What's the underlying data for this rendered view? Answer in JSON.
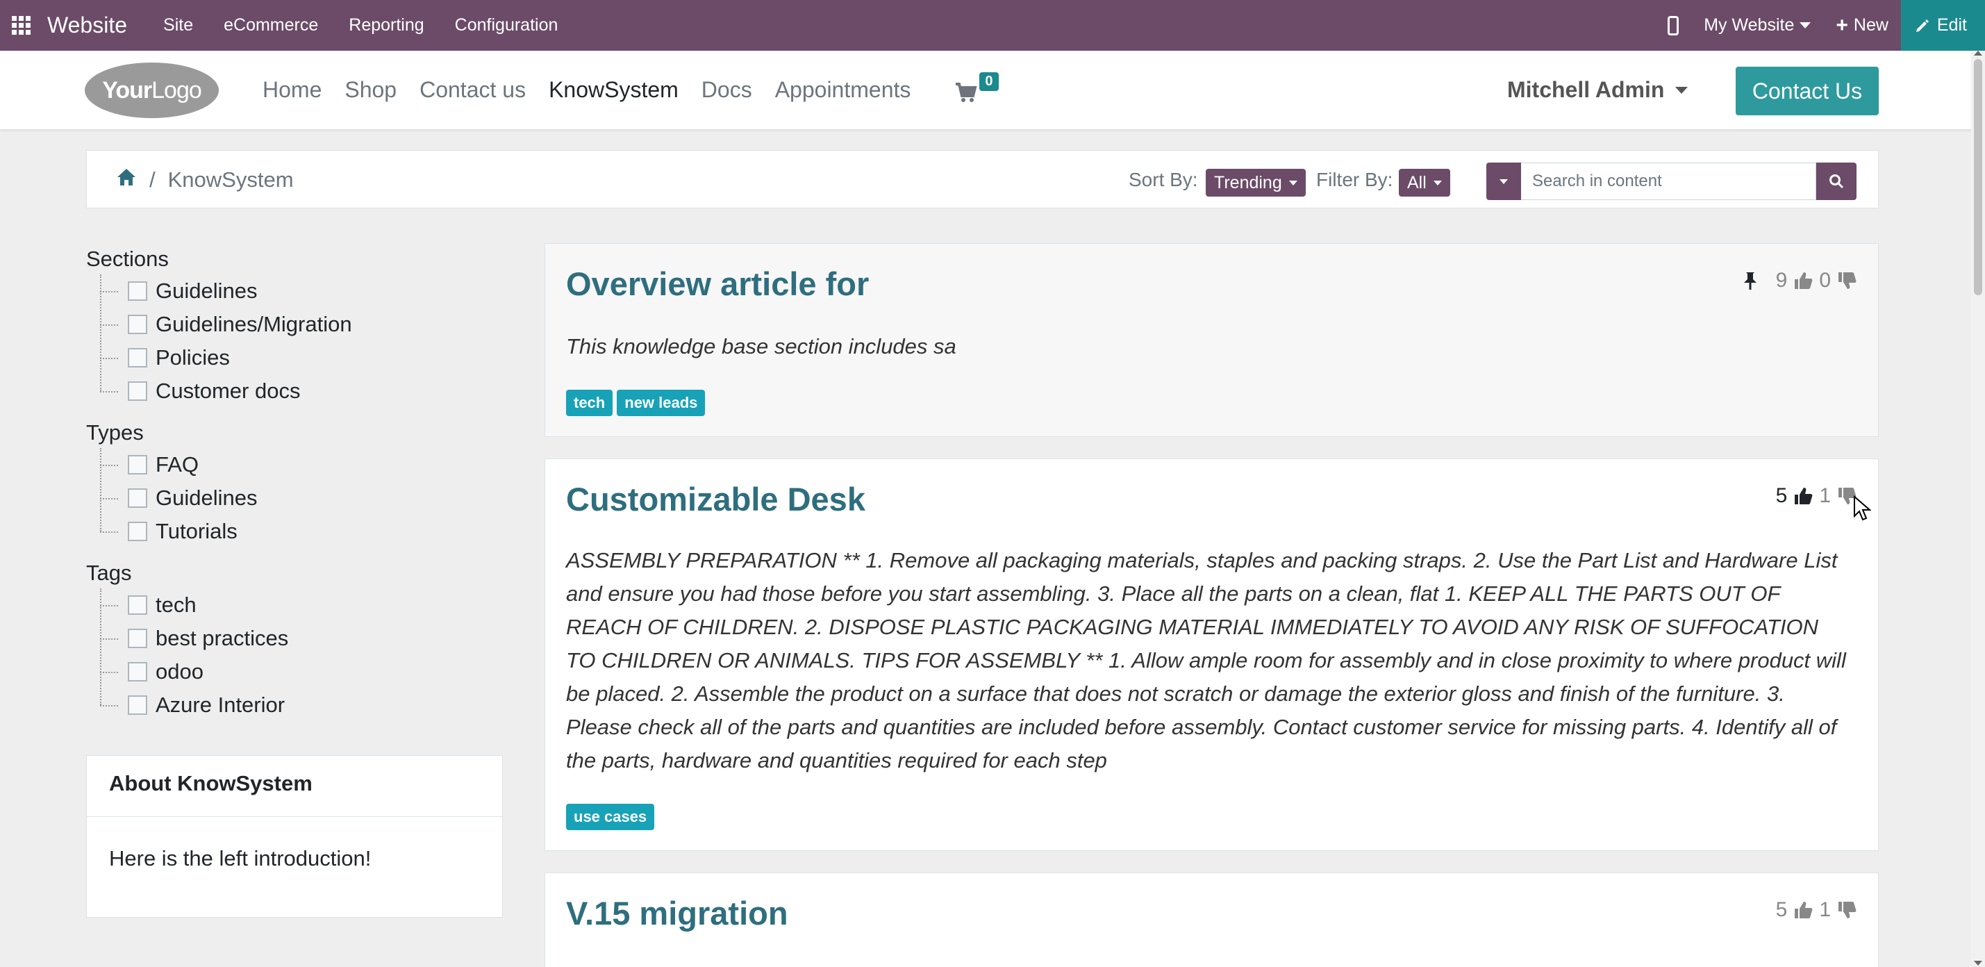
{
  "topbar": {
    "brand": "Website",
    "menus": [
      "Site",
      "eCommerce",
      "Reporting",
      "Configuration"
    ],
    "website_selector": "My Website",
    "new_label": "New",
    "edit_label": "Edit"
  },
  "header": {
    "logo": {
      "bold": "Your",
      "thin": "Logo"
    },
    "nav": [
      "Home",
      "Shop",
      "Contact us",
      "KnowSystem",
      "Docs",
      "Appointments"
    ],
    "active_nav": "KnowSystem",
    "cart_count": "0",
    "user_name": "Mitchell Admin",
    "contact_button": "Contact Us"
  },
  "filterbar": {
    "breadcrumb": "KnowSystem",
    "sort_label": "Sort By:",
    "sort_value": "Trending",
    "filter_label": "Filter By:",
    "filter_value": "All",
    "search_placeholder": "Search in content"
  },
  "sidebar": {
    "sections_title": "Sections",
    "sections": [
      "Guidelines",
      "Guidelines/Migration",
      "Policies",
      "Customer docs"
    ],
    "types_title": "Types",
    "types": [
      "FAQ",
      "Guidelines",
      "Tutorials"
    ],
    "tags_title": "Tags",
    "tags": [
      "tech",
      "best practices",
      "odoo",
      "Azure Interior"
    ],
    "about_title": "About KnowSystem",
    "about_text": "Here is the left introduction!"
  },
  "articles": [
    {
      "title": "Overview article for",
      "text": "This knowledge base section includes sa",
      "tags": [
        "tech",
        "new leads"
      ],
      "likes": "9",
      "dislikes": "0",
      "pinned": true
    },
    {
      "title": "Customizable Desk",
      "text": "ASSEMBLY PREPARATION ** 1. Remove all packaging materials, staples and packing straps. 2. Use the Part List and Hardware List and ensure you had those before you start assembling. 3. Place all the parts on a clean, flat 1. KEEP ALL THE PARTS OUT OF REACH OF CHILDREN. 2. DISPOSE PLASTIC PACKAGING MATERIAL IMMEDIATELY TO AVOID ANY RISK OF SUFFOCATION TO CHILDREN OR ANIMALS. TIPS FOR ASSEMBLY ** 1. Allow ample room for assembly and in close proximity to where product will be placed. 2. Assemble the product on a surface that does not scratch or damage the exterior gloss and finish of the furniture. 3. Please check all of the parts and quantities are included before assembly. Contact customer service for missing parts. 4. Identify all of the parts, hardware and quantities required for each step",
      "tags": [
        "use cases"
      ],
      "likes": "5",
      "dislikes": "1",
      "liked": true
    },
    {
      "title": "V.15 migration",
      "likes": "5",
      "dislikes": "1"
    }
  ],
  "colors": {
    "admin_bar": "#6b4b68",
    "accent": "#2e9a9e",
    "title": "#2e6e7e",
    "tag": "#17a2b8"
  }
}
